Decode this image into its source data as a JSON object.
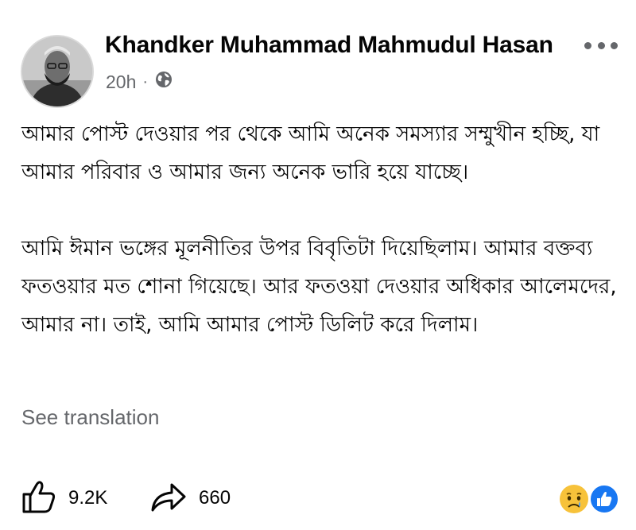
{
  "post": {
    "author_name": "Khandker Muhammad Mahmudul Hasan",
    "time": "20h",
    "meta_separator": "·",
    "audience_icon": "globe-icon",
    "paragraphs": [
      "আমার পোস্ট দেওয়ার পর থেকে আমি অনেক সমস্যার সম্মুখীন হচ্ছি, যা আমার পরিবার ও আমার জন্য অনেক ভারি হয়ে যাচ্ছে।",
      "আমি ঈমান ভঙ্গের মূলনীতির উপর বিবৃতিটা দিয়েছিলাম। আমার বক্তব্য ফতওয়ার মত শোনা গিয়েছে। আর ফতওয়া দেওয়ার অধিকার আলেমদের, আমার না। তাই, আমি আমার পোস্ট ডিলিট করে দিলাম।"
    ],
    "see_translation": "See translation"
  },
  "actions": {
    "like_count": "9.2K",
    "share_count": "660",
    "like_icon": "thumbs-up-icon",
    "share_icon": "share-arrow-icon"
  },
  "reactions": [
    "sad-icon",
    "like-reaction-icon"
  ],
  "colors": {
    "text": "#050505",
    "secondary": "#65676b",
    "like_blue": "#1877f2",
    "sad_yellow": "#f7c23a"
  }
}
